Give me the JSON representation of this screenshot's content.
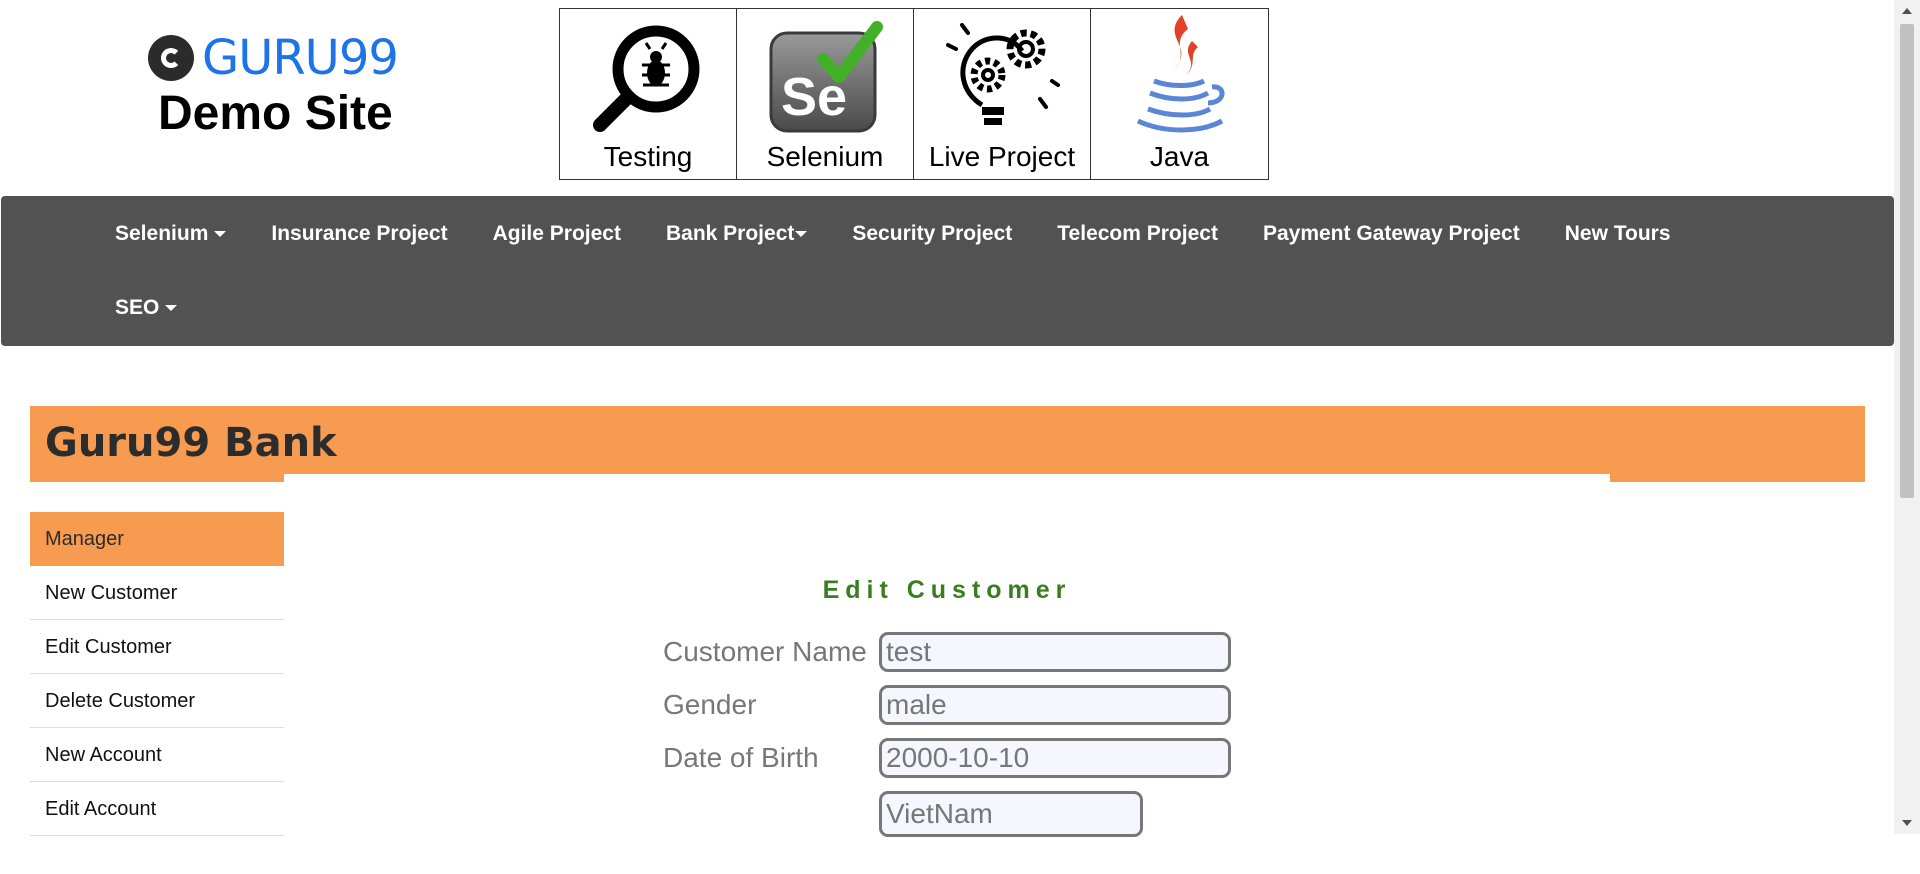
{
  "header": {
    "logo_brand": "GURU99",
    "logo_subtitle": "Demo Site",
    "tiles": [
      {
        "label": "Testing",
        "icon": "bug-magnifier-icon"
      },
      {
        "label": "Selenium",
        "icon": "selenium-icon"
      },
      {
        "label": "Live Project",
        "icon": "lightbulb-gears-icon"
      },
      {
        "label": "Java",
        "icon": "java-cup-icon"
      }
    ]
  },
  "nav": {
    "items": [
      {
        "label": "Selenium",
        "dropdown": true
      },
      {
        "label": "Insurance Project",
        "dropdown": false
      },
      {
        "label": "Agile Project",
        "dropdown": false
      },
      {
        "label": "Bank Project",
        "dropdown": true
      },
      {
        "label": "Security Project",
        "dropdown": false
      },
      {
        "label": "Telecom Project",
        "dropdown": false
      },
      {
        "label": "Payment Gateway Project",
        "dropdown": false
      },
      {
        "label": "New Tours",
        "dropdown": false
      },
      {
        "label": "SEO",
        "dropdown": true
      }
    ]
  },
  "bank": {
    "title": "Guru99 Bank"
  },
  "sidebar": {
    "items": [
      {
        "label": "Manager",
        "active": true
      },
      {
        "label": "New Customer",
        "active": false
      },
      {
        "label": "Edit Customer",
        "active": false
      },
      {
        "label": "Delete Customer",
        "active": false
      },
      {
        "label": "New Account",
        "active": false
      },
      {
        "label": "Edit Account",
        "active": false
      }
    ]
  },
  "form": {
    "title": "Edit Customer",
    "fields": [
      {
        "label": "Customer Name",
        "value": "test"
      },
      {
        "label": "Gender",
        "value": "male"
      },
      {
        "label": "Date of Birth",
        "value": "2000-10-10"
      },
      {
        "label": "",
        "value": "VietNam"
      }
    ]
  },
  "colors": {
    "accent_orange": "#f79b51",
    "navbar_bg": "#525252",
    "form_title_green": "#3a7d1e",
    "logo_blue": "#1c74e8"
  }
}
